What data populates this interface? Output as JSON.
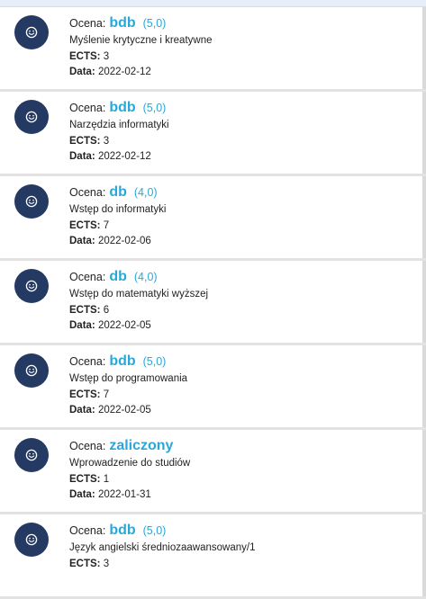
{
  "labels": {
    "grade": "Ocena:",
    "ects": "ECTS:",
    "date": "Data:"
  },
  "colors": {
    "avatar": "#243a63",
    "grade_accent": "#2aa7d8",
    "card_bg": "#ffffff",
    "page_bg": "#e9e9e9"
  },
  "avatar_icon": "smiley-face-icon",
  "courses": [
    {
      "grade": "bdb",
      "grade_num": "(5,0)",
      "course": "Myślenie krytyczne i kreatywne",
      "ects": "3",
      "date": "2022-02-12"
    },
    {
      "grade": "bdb",
      "grade_num": "(5,0)",
      "course": "Narzędzia informatyki",
      "ects": "3",
      "date": "2022-02-12"
    },
    {
      "grade": "db",
      "grade_num": "(4,0)",
      "course": "Wstęp do informatyki",
      "ects": "7",
      "date": "2022-02-06"
    },
    {
      "grade": "db",
      "grade_num": "(4,0)",
      "course": "Wstęp do matematyki wyższej",
      "ects": "6",
      "date": "2022-02-05"
    },
    {
      "grade": "bdb",
      "grade_num": "(5,0)",
      "course": "Wstęp do programowania",
      "ects": "7",
      "date": "2022-02-05"
    },
    {
      "grade": "zaliczony",
      "grade_num": "",
      "course": "Wprowadzenie do studiów",
      "ects": "1",
      "date": "2022-01-31"
    },
    {
      "grade": "bdb",
      "grade_num": "(5,0)",
      "course": "Język angielski średniozaawansowany/1",
      "ects": "3",
      "date": ""
    }
  ]
}
